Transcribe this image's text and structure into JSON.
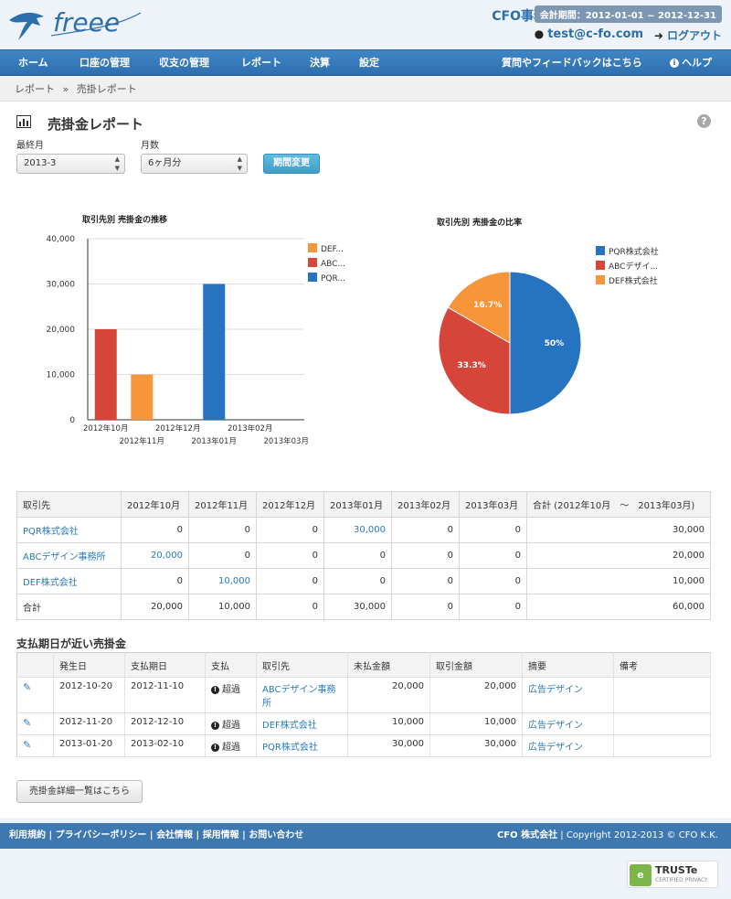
{
  "header": {
    "company": "CFO事務所",
    "period": "会計期間：2012-01-01 ~ 2012-12-31",
    "user_email": "test@c-fo.com",
    "logout": "ログアウト"
  },
  "nav": {
    "items": [
      "ホーム",
      "口座の管理",
      "収支の管理",
      "レポート",
      "決算",
      "設定"
    ],
    "feedback": "質問やフィードバックはこちら",
    "help": "ヘルプ"
  },
  "breadcrumb": {
    "parent": "レポート",
    "sep": "»",
    "current": "売掛レポート"
  },
  "page": {
    "title": "売掛金レポート",
    "last_month_label": "最終月",
    "last_month_value": "2013-3",
    "months_label": "月数",
    "months_value": "6ヶ月分",
    "period_button": "期間変更"
  },
  "chart_data": [
    {
      "type": "bar",
      "title": "取引先別 売掛金の推移",
      "categories": [
        "2012年10月",
        "2012年11月",
        "2012年12月",
        "2013年01月",
        "2013年02月",
        "2013年03月"
      ],
      "series": [
        {
          "name": "DEF...",
          "color": "#f7953b",
          "values": [
            0,
            10000,
            0,
            0,
            0,
            0
          ]
        },
        {
          "name": "ABC...",
          "color": "#d6453a",
          "values": [
            20000,
            0,
            0,
            0,
            0,
            0
          ]
        },
        {
          "name": "PQR...",
          "color": "#2673bf",
          "values": [
            0,
            0,
            0,
            30000,
            0,
            0
          ]
        }
      ],
      "ylim": [
        0,
        40000
      ],
      "yticks": [
        "0",
        "10,000",
        "20,000",
        "30,000",
        "40,000"
      ],
      "legend": "right"
    },
    {
      "type": "pie",
      "title": "取引先別 売掛金の比率",
      "slices": [
        {
          "name": "PQR株式会社",
          "value": 50,
          "label": "50%",
          "color": "#2673bf"
        },
        {
          "name": "ABCデザイ...",
          "value": 33.3,
          "label": "33.3%",
          "color": "#d6453a"
        },
        {
          "name": "DEF株式会社",
          "value": 16.7,
          "label": "16.7%",
          "color": "#f7953b"
        }
      ],
      "legend": "right"
    }
  ],
  "sales_table": {
    "headers": [
      "取引先",
      "2012年10月",
      "2012年11月",
      "2012年12月",
      "2013年01月",
      "2013年02月",
      "2013年03月",
      "合計 (2012年10月　～　2013年03月)"
    ],
    "rows": [
      {
        "name": "PQR株式会社",
        "cells": [
          "0",
          "0",
          "0",
          "30,000",
          "0",
          "0"
        ],
        "total": "30,000"
      },
      {
        "name": "ABCデザイン事務所",
        "cells": [
          "20,000",
          "0",
          "0",
          "0",
          "0",
          "0"
        ],
        "total": "20,000"
      },
      {
        "name": "DEF株式会社",
        "cells": [
          "0",
          "10,000",
          "0",
          "0",
          "0",
          "0"
        ],
        "total": "10,000"
      },
      {
        "name": "合計",
        "cells": [
          "20,000",
          "10,000",
          "0",
          "30,000",
          "0",
          "0"
        ],
        "total": "60,000"
      }
    ]
  },
  "due_section": {
    "title": "支払期日が近い売掛金",
    "headers": [
      "",
      "発生日",
      "支払期日",
      "支払",
      "取引先",
      "未払金額",
      "取引金額",
      "摘要",
      "備考"
    ],
    "rows": [
      {
        "issue": "2012-10-20",
        "due": "2012-11-10",
        "status": "超過",
        "partner": "ABCデザイン事務所",
        "unpaid": "20,000",
        "amount": "20,000",
        "memo": "広告デザイン",
        "note": ""
      },
      {
        "issue": "2012-11-20",
        "due": "2012-12-10",
        "status": "超過",
        "partner": "DEF株式会社",
        "unpaid": "10,000",
        "amount": "10,000",
        "memo": "広告デザイン",
        "note": ""
      },
      {
        "issue": "2013-01-20",
        "due": "2013-02-10",
        "status": "超過",
        "partner": "PQR株式会社",
        "unpaid": "30,000",
        "amount": "30,000",
        "memo": "広告デザイン",
        "note": ""
      }
    ],
    "detail_button": "売掛金詳細一覧はこちら"
  },
  "footer": {
    "links": [
      "利用規約",
      "プライバシーポリシー",
      "会社情報",
      "採用情報",
      "お問い合わせ"
    ],
    "company": "CFO 株式会社",
    "copyright": "Copyright 2012-2013 © CFO K.K.",
    "truste_title": "TRUSTe",
    "truste_sub": "CERTIFIED PRIVACY"
  },
  "logo_text": "freee",
  "icons": {
    "logo": "swallow-logo-icon",
    "user": "user-icon",
    "logout": "logout-icon",
    "help": "info-icon",
    "report": "bar-chart-icon",
    "question": "question-icon",
    "overdue": "exclamation-icon",
    "edit": "pencil-icon"
  }
}
